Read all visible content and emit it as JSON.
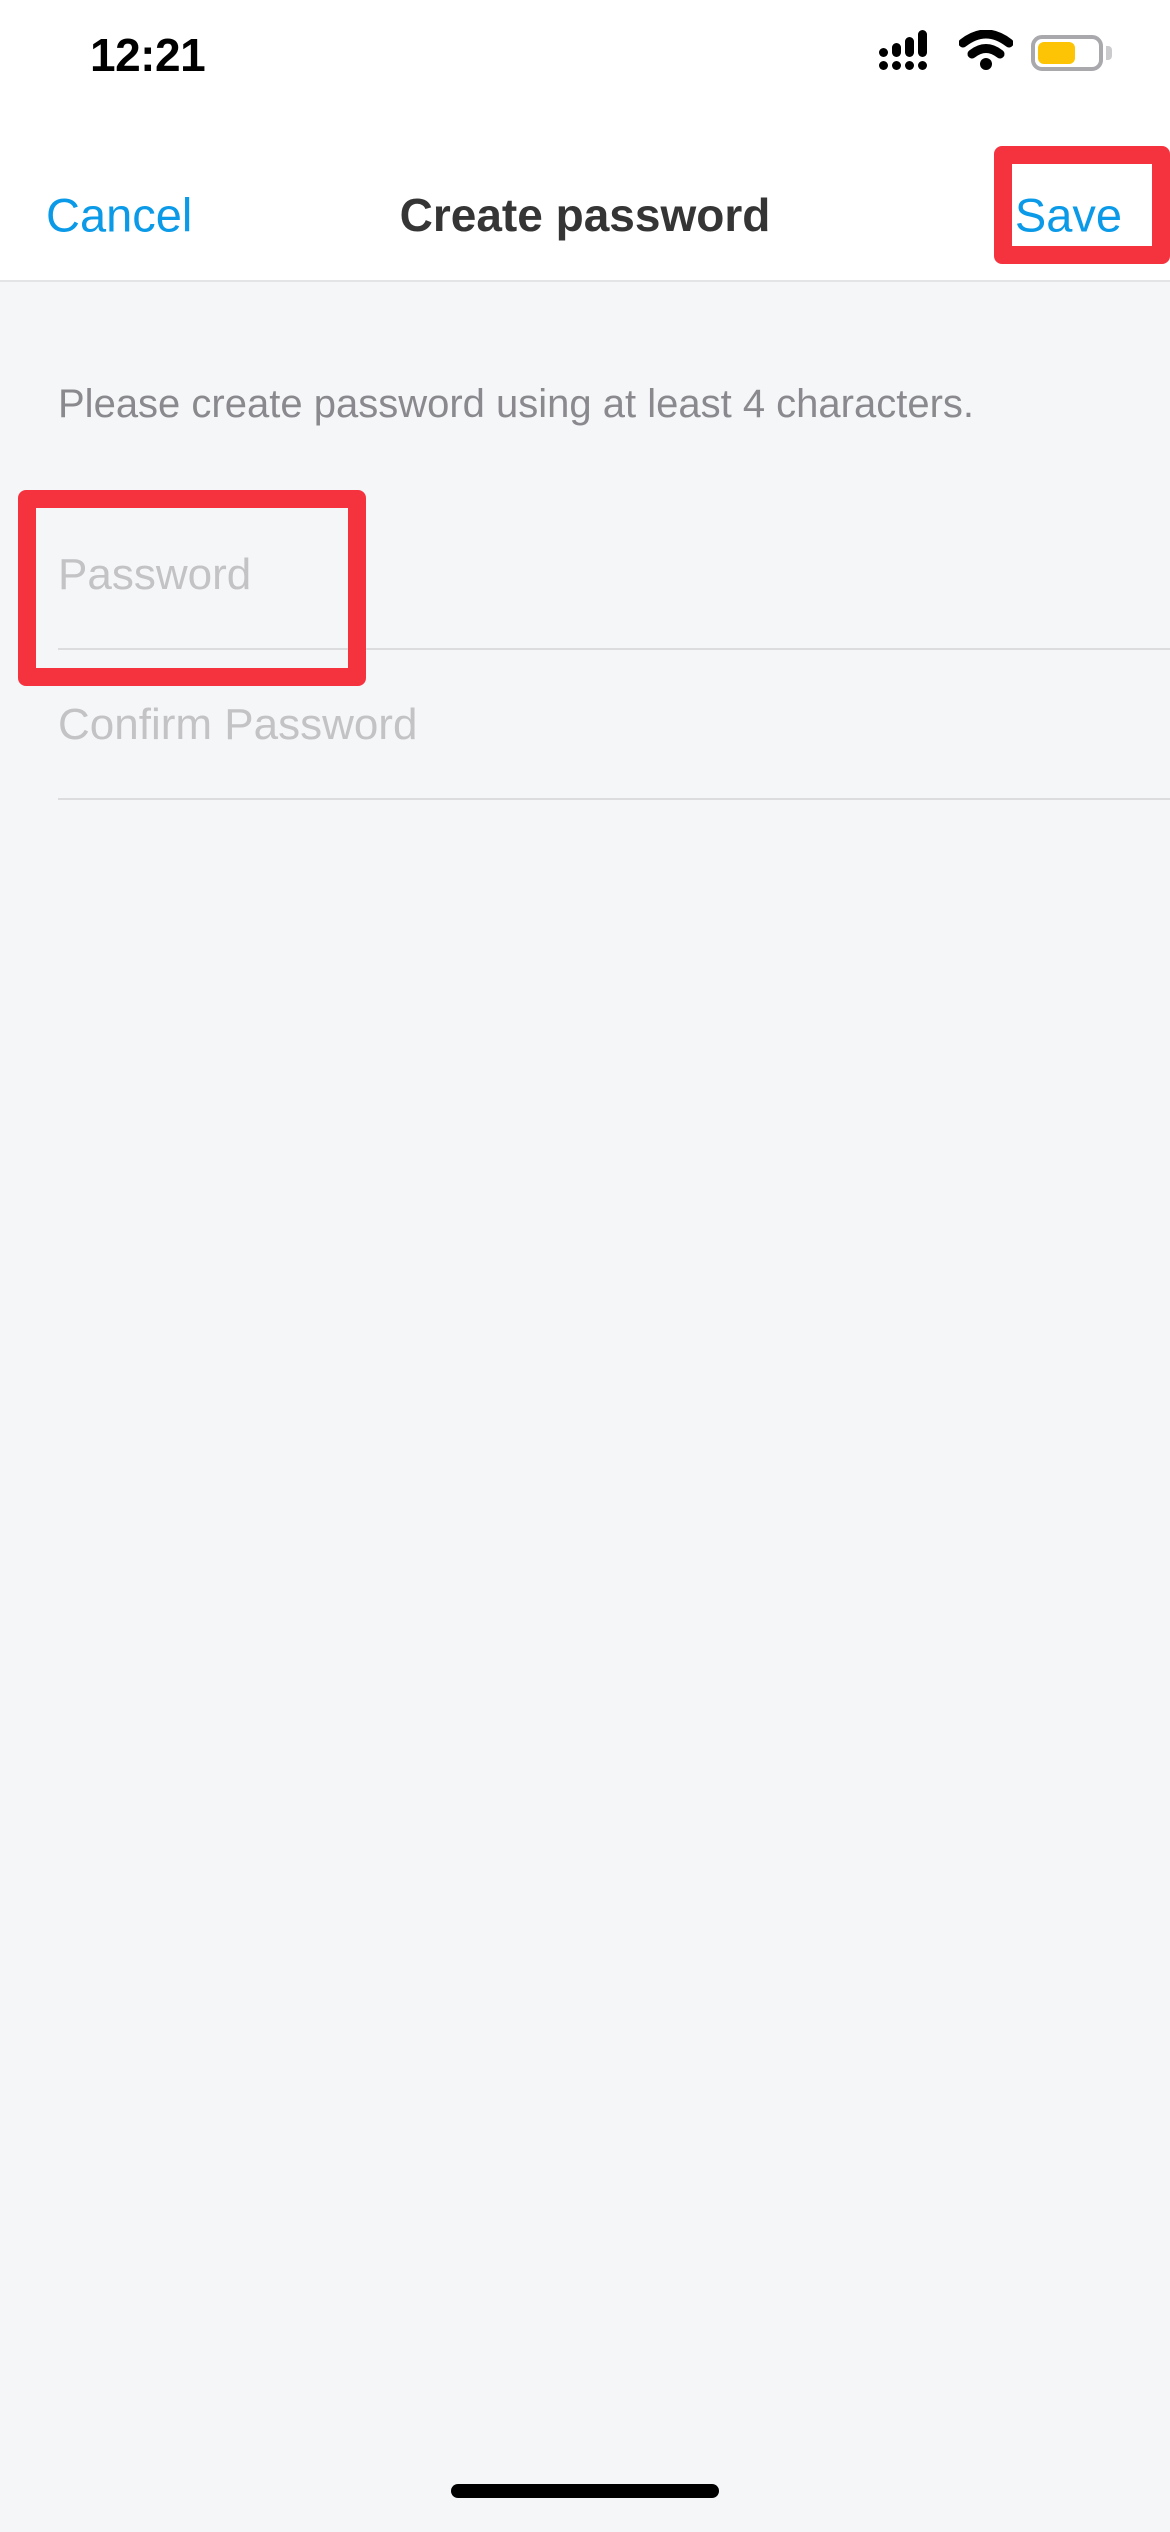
{
  "status_bar": {
    "time": "12:21",
    "signal_icon": "cellular-signal-icon",
    "wifi_icon": "wifi-icon",
    "battery_icon": "battery-icon",
    "battery_level_percent": 58,
    "battery_color": "#fcc404"
  },
  "nav_bar": {
    "cancel_label": "Cancel",
    "title": "Create password",
    "save_label": "Save",
    "accent_color": "#0a9ae8"
  },
  "content": {
    "hint": "Please create password using at least 4 characters.",
    "fields": [
      {
        "name": "password",
        "placeholder": "Password",
        "value": ""
      },
      {
        "name": "confirm-password",
        "placeholder": "Confirm Password",
        "value": ""
      }
    ]
  },
  "annotations": {
    "color": "#f5333f",
    "boxes": [
      {
        "target": "save-button"
      },
      {
        "target": "password-fields"
      }
    ]
  },
  "home_indicator": {
    "present": true
  }
}
